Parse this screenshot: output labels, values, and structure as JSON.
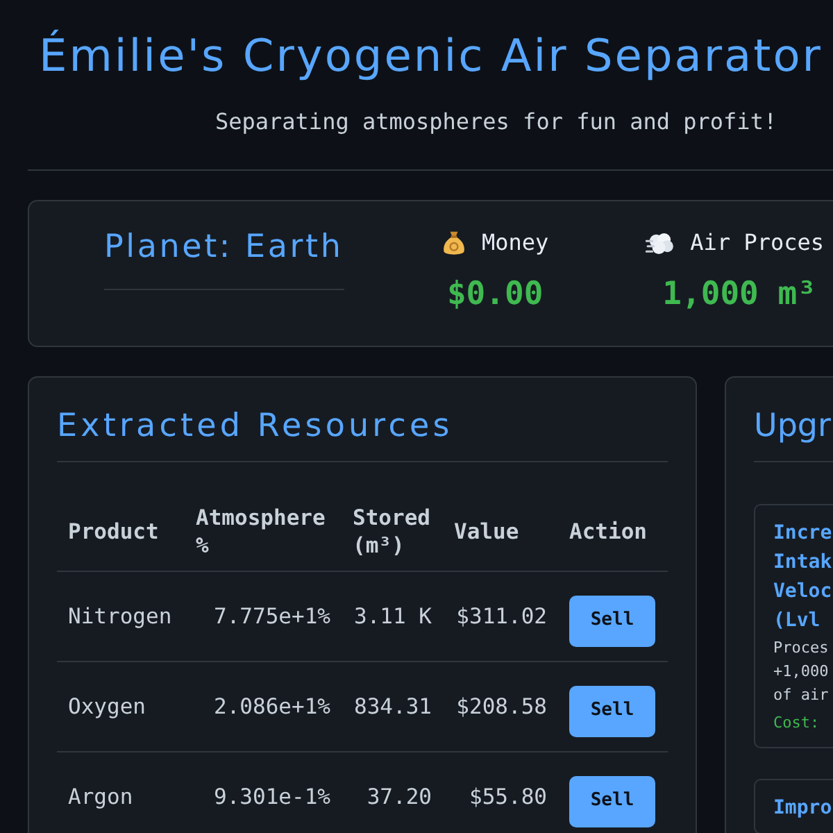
{
  "header": {
    "title": "Émilie's Cryogenic Air Separator",
    "subtitle": "Separating atmospheres for fun and profit!"
  },
  "stats": {
    "planet": "Planet: Earth",
    "items": [
      {
        "kind": "money",
        "label": "Money",
        "value": "$0.00"
      },
      {
        "kind": "air",
        "label": "Air Proces",
        "value": "1,000 m³"
      }
    ]
  },
  "resources": {
    "title": "Extracted Resources",
    "columns": [
      "Product",
      "Atmosphere %",
      "Stored (m³)",
      "Value",
      "Action"
    ],
    "rows": [
      {
        "product": "Nitrogen",
        "atmosphere": "7.775e+1%",
        "stored": "3.11 K",
        "value": "$311.02",
        "action": "Sell"
      },
      {
        "product": "Oxygen",
        "atmosphere": "2.086e+1%",
        "stored": "834.31",
        "value": "$208.58",
        "action": "Sell"
      },
      {
        "product": "Argon",
        "atmosphere": "9.301e-1%",
        "stored": "37.20",
        "value": "$55.80",
        "action": "Sell"
      }
    ]
  },
  "upgrades": {
    "title": "Upgr",
    "cards": [
      {
        "title": "Incre Intak Veloc (Lvl",
        "description": "Proces +1,000 of air",
        "cost": "Cost:"
      },
      {
        "title": "Impro"
      }
    ]
  }
}
